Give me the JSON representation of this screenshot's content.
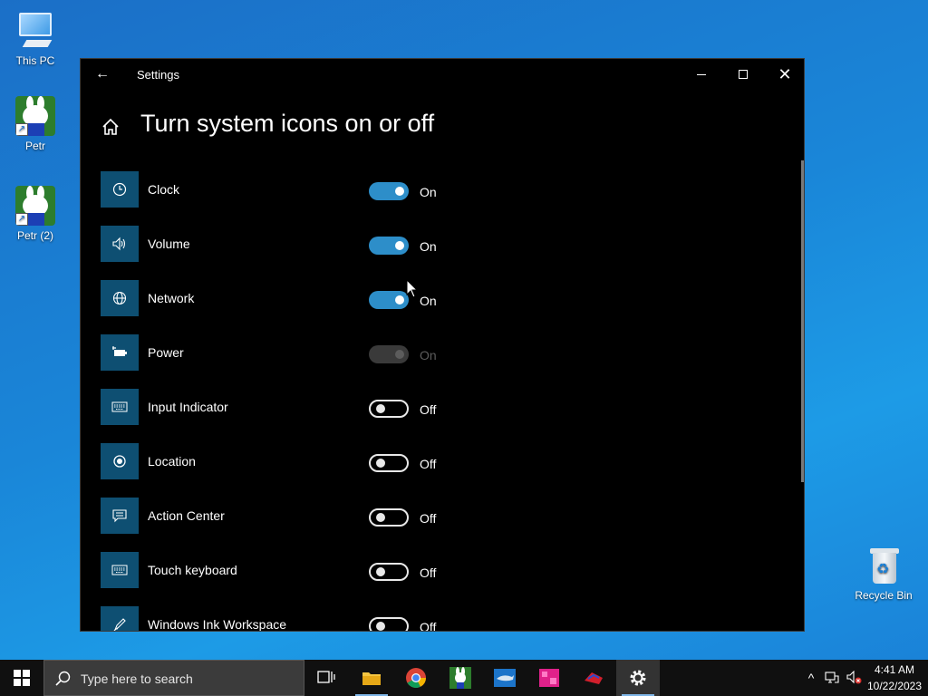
{
  "desktop": {
    "icons": [
      {
        "label": "This PC"
      },
      {
        "label": "Petr"
      },
      {
        "label": "Petr (2)"
      },
      {
        "label": "Recycle Bin"
      }
    ]
  },
  "window": {
    "title": "Settings",
    "page_title": "Turn system icons on or off",
    "items": [
      {
        "label": "Clock",
        "state": "On",
        "icon": "clock-icon"
      },
      {
        "label": "Volume",
        "state": "On",
        "icon": "volume-icon"
      },
      {
        "label": "Network",
        "state": "On",
        "icon": "network-icon"
      },
      {
        "label": "Power",
        "state": "On",
        "icon": "power-icon",
        "disabled": true
      },
      {
        "label": "Input Indicator",
        "state": "Off",
        "icon": "keyboard-icon"
      },
      {
        "label": "Location",
        "state": "Off",
        "icon": "location-icon"
      },
      {
        "label": "Action Center",
        "state": "Off",
        "icon": "action-center-icon"
      },
      {
        "label": "Touch keyboard",
        "state": "Off",
        "icon": "touch-keyboard-icon"
      },
      {
        "label": "Windows Ink Workspace",
        "state": "Off",
        "icon": "pen-icon"
      }
    ]
  },
  "taskbar": {
    "search_placeholder": "Type here to search",
    "apps": [
      "task-view",
      "file-explorer",
      "chrome",
      "petr",
      "shark-app",
      "puzzle-app",
      "shoe-app",
      "settings"
    ],
    "clock_time": "4:41 AM",
    "clock_date": "10/22/2023"
  },
  "colors": {
    "toggle_on": "#2d8ec9",
    "icon_tile": "#0e4f72",
    "window_bg": "#000000",
    "taskbar_bg": "#101010"
  }
}
